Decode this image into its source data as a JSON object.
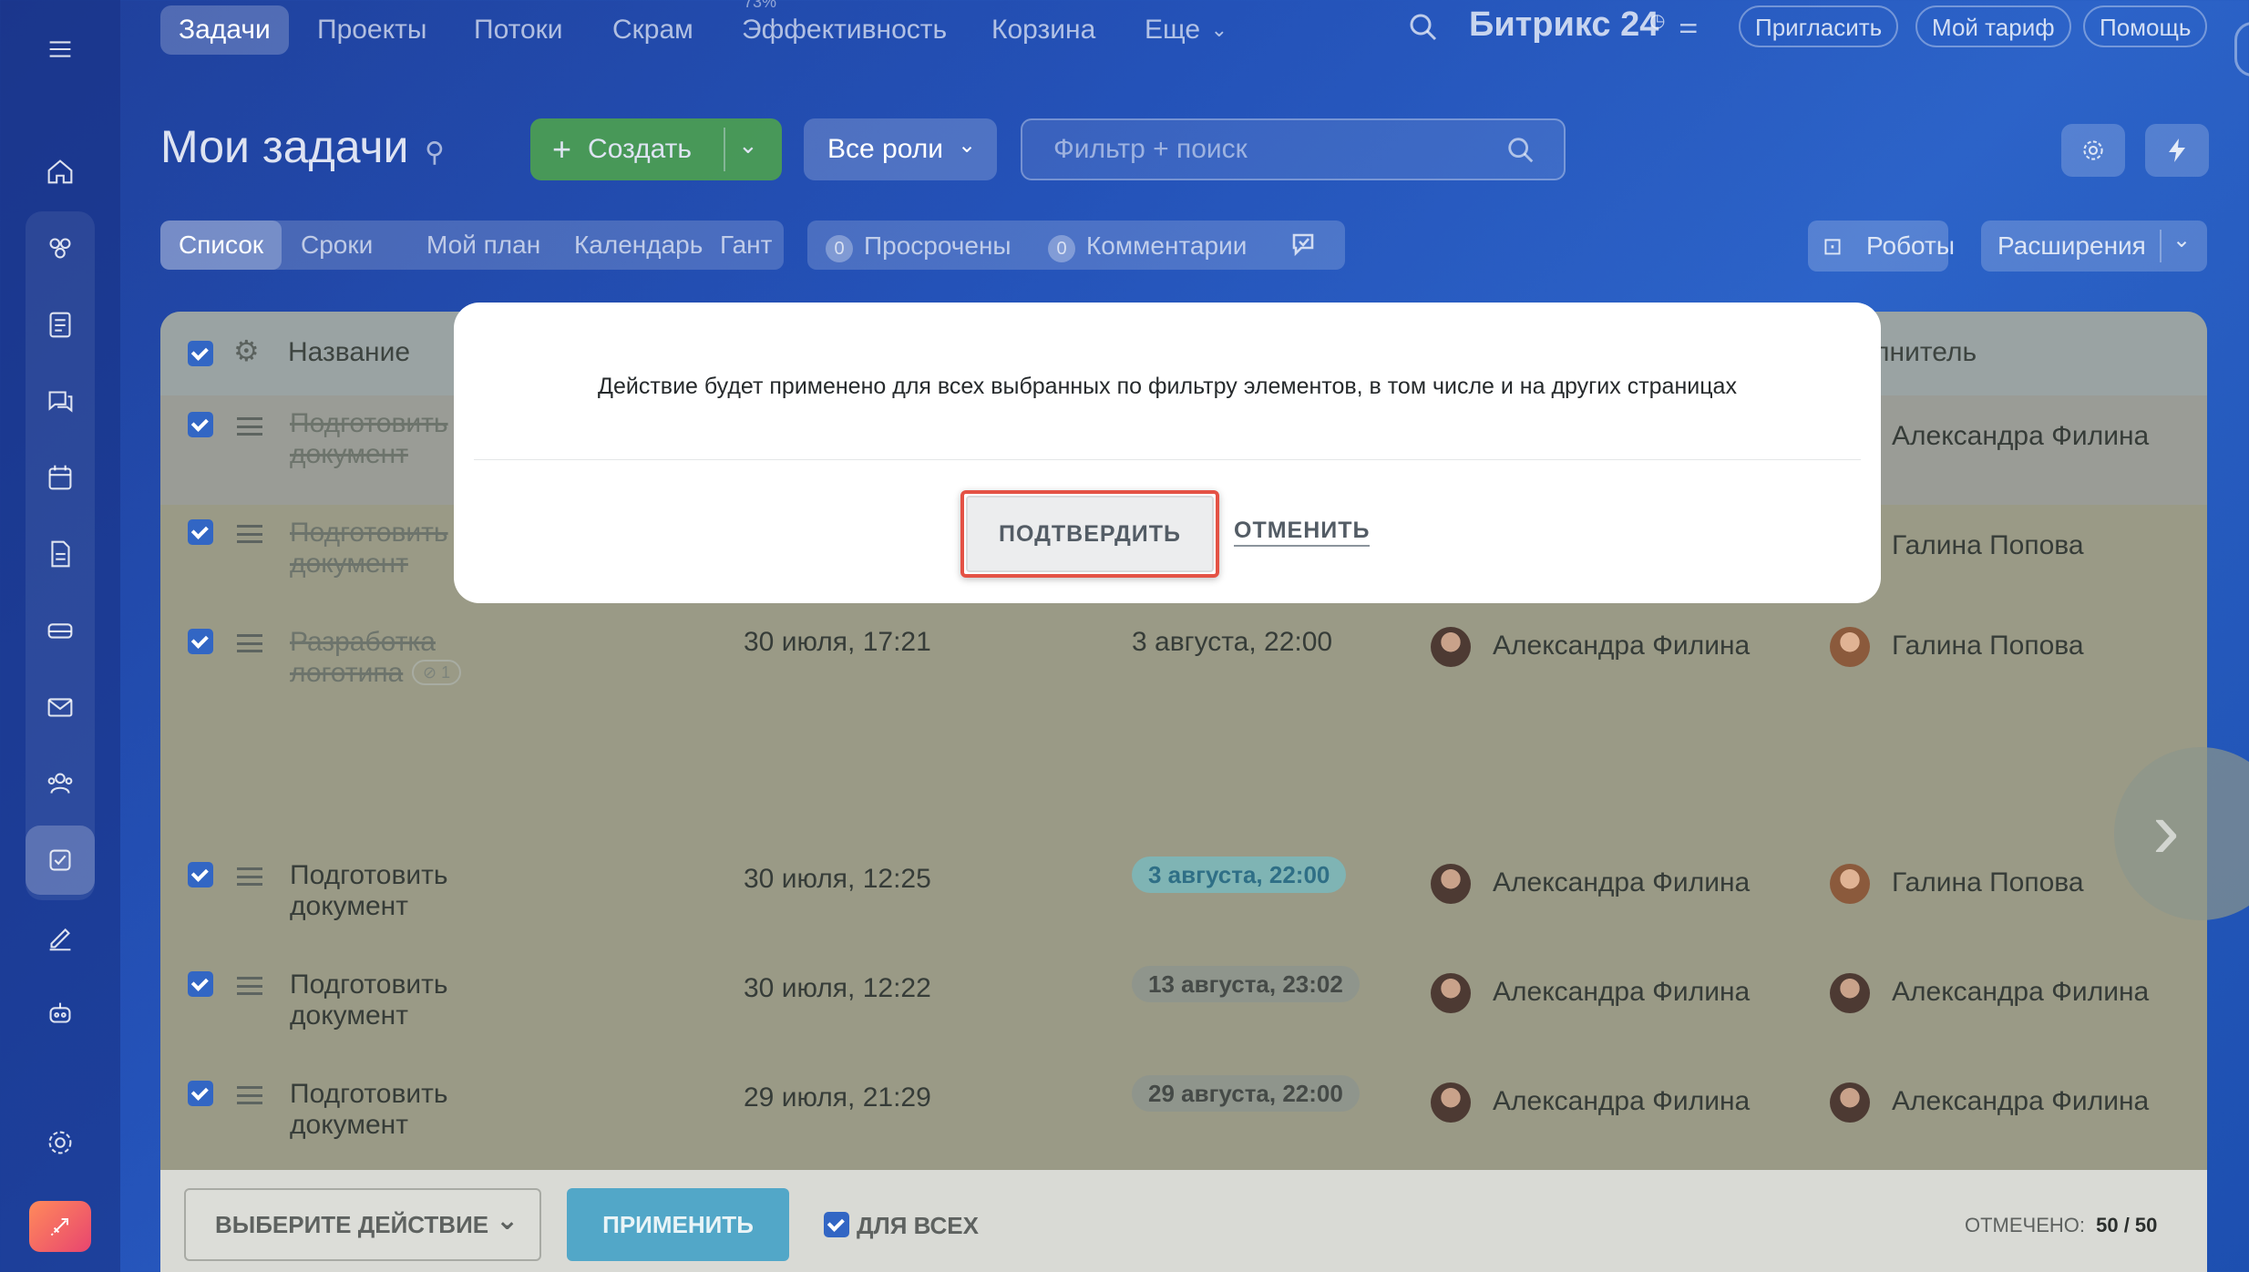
{
  "colors": {
    "accent": "#2c63c8",
    "create_green": "#4fa64a",
    "apply_blue": "#52a7c8",
    "highlight_red": "#e45245",
    "checkbox_blue": "#3266c4"
  },
  "topnav": {
    "items": [
      "Задачи",
      "Проекты",
      "Потоки",
      "Скрам",
      "Эффективность",
      "Корзина",
      "Еще"
    ],
    "efficiency_badge": "73%",
    "brand": "Битрикс 24",
    "invite": "Пригласить",
    "tariff": "Мой тариф",
    "help": "Помощь"
  },
  "header": {
    "title": "Мои задачи",
    "create_label": "Создать",
    "roles_label": "Все роли",
    "search_placeholder": "Фильтр + поиск"
  },
  "views": {
    "tabs": [
      "Список",
      "Сроки",
      "Мой план",
      "Календарь",
      "Гант"
    ],
    "overdue_count": "0",
    "overdue_label": "Просрочены",
    "comments_count": "0",
    "comments_label": "Комментарии",
    "robots_label": "Роботы",
    "extensions_label": "Расширения"
  },
  "table": {
    "col_name": "Название",
    "col_assignee_partial": "олнитель",
    "rows": [
      {
        "name": "Подготовить документ",
        "created": "",
        "deadline": "",
        "creator": "",
        "assignee": "Александра Филина",
        "done": true
      },
      {
        "name": "Подготовить документ",
        "created": "",
        "deadline": "",
        "creator": "",
        "assignee": "Галина Попова",
        "done": true
      },
      {
        "name": "Разработка логотипа",
        "attach": "1",
        "created": "30 июля, 17:21",
        "deadline": "3 августа, 22:00",
        "creator": "Александра Филина",
        "assignee": "Галина Попова",
        "done": true
      },
      {
        "name": "Подготовить документ",
        "created": "30 июля, 12:25",
        "deadline": "3 августа, 22:00",
        "creator": "Александра Филина",
        "assignee": "Галина Попова",
        "done": false
      },
      {
        "name": "Подготовить документ",
        "created": "30 июля, 12:22",
        "deadline": "13 августа, 23:02",
        "creator": "Александра Филина",
        "assignee": "Александра Филина",
        "done": false
      },
      {
        "name": "Подготовить документ",
        "created": "29 июля, 21:29",
        "deadline": "29 августа, 22:00",
        "creator": "Александра Филина",
        "assignee": "Александра Филина",
        "done": false
      }
    ]
  },
  "actionbar": {
    "select_label": "ВЫБЕРИТЕ ДЕЙСТВИЕ",
    "apply_label": "ПРИМЕНИТЬ",
    "for_all_label": "ДЛЯ ВСЕХ",
    "selected_label": "ОТМЕЧЕНО:",
    "selected_value": "50 / 50"
  },
  "modal": {
    "message": "Действие будет применено для всех выбранных по фильтру элементов, в том числе и на других страницах",
    "confirm_label": "ПОДТВЕРДИТЬ",
    "cancel_label": "ОТМЕНИТЬ"
  }
}
